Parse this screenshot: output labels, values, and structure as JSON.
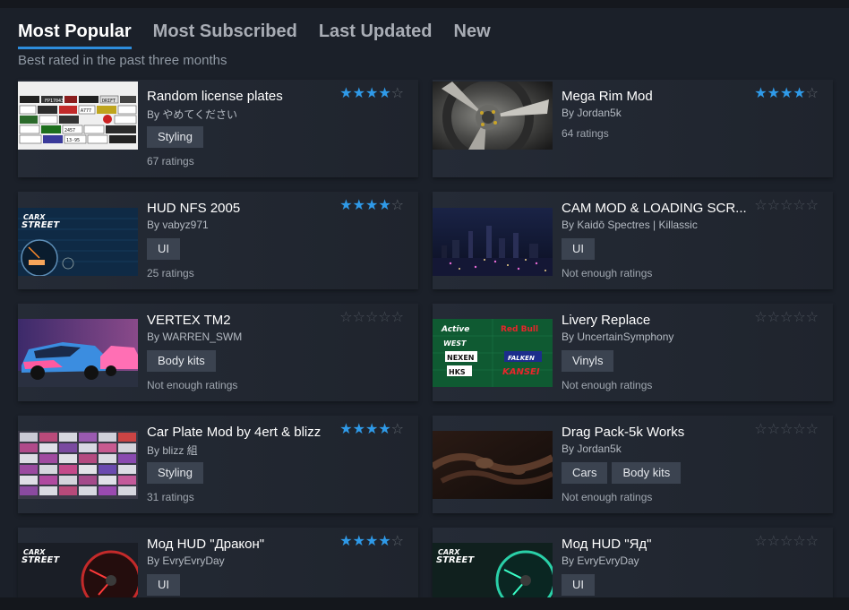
{
  "tabs": [
    {
      "label": "Most Popular",
      "active": true
    },
    {
      "label": "Most Subscribed",
      "active": false
    },
    {
      "label": "Last Updated",
      "active": false
    },
    {
      "label": "New",
      "active": false
    }
  ],
  "subtitle": "Best rated in the past three months",
  "colors": {
    "accent": "#2d8cdb",
    "star": "#2f9ae8",
    "background": "#1b2029",
    "card": "#252b36",
    "tag": "#3b4350"
  },
  "items": [
    {
      "title": "Random license plates",
      "author": "By やめてください",
      "tags": [
        "Styling"
      ],
      "ratings": "67 ratings",
      "stars": 4,
      "thumb_texts": [
        "FP17043",
        "DRIFT",
        "A777",
        "2457",
        "13-95"
      ]
    },
    {
      "title": "Mega Rim Mod",
      "author": "By Jordan5k",
      "tags": [],
      "ratings": "64 ratings",
      "stars": 4
    },
    {
      "title": "HUD NFS 2005",
      "author": "By vabyz971",
      "tags": [
        "UI"
      ],
      "ratings": "25 ratings",
      "stars": 4,
      "thumb_texts": [
        "CARX",
        "STREET"
      ]
    },
    {
      "title": "CAM MOD & LOADING SCR...",
      "author": "By Kaidō Spectres | Killassic",
      "tags": [
        "UI"
      ],
      "ratings": "Not enough ratings",
      "stars": 0
    },
    {
      "title": "VERTEX TM2",
      "author": "By WARREN_SWM",
      "tags": [
        "Body kits"
      ],
      "ratings": "Not enough ratings",
      "stars": 0
    },
    {
      "title": "Livery Replace",
      "author": "By UncertainSymphony",
      "tags": [
        "Vinyls"
      ],
      "ratings": "Not enough ratings",
      "stars": 0,
      "thumb_texts": [
        "Active",
        "Red Bull",
        "WEST",
        "NEXEN",
        "FALKEN",
        "HKS",
        "KANSEI"
      ]
    },
    {
      "title": "Car Plate Mod by 4ert & blizz",
      "author": "By blizz 組",
      "tags": [
        "Styling"
      ],
      "ratings": "31 ratings",
      "stars": 4
    },
    {
      "title": "Drag Pack-5k Works",
      "author": "By Jordan5k",
      "tags": [
        "Cars",
        "Body kits"
      ],
      "ratings": "Not enough ratings",
      "stars": 0
    },
    {
      "title": "Мод HUD \"Дракон\"",
      "author": "By EvryEvryDay",
      "tags": [
        "UI"
      ],
      "ratings": "",
      "stars": 4,
      "thumb_texts": [
        "CARX",
        "STREET"
      ]
    },
    {
      "title": "Мод HUD \"Яд\"",
      "author": "By EvryEvryDay",
      "tags": [
        "UI"
      ],
      "ratings": "",
      "stars": 0,
      "thumb_texts": [
        "CARX",
        "STREET"
      ]
    }
  ]
}
